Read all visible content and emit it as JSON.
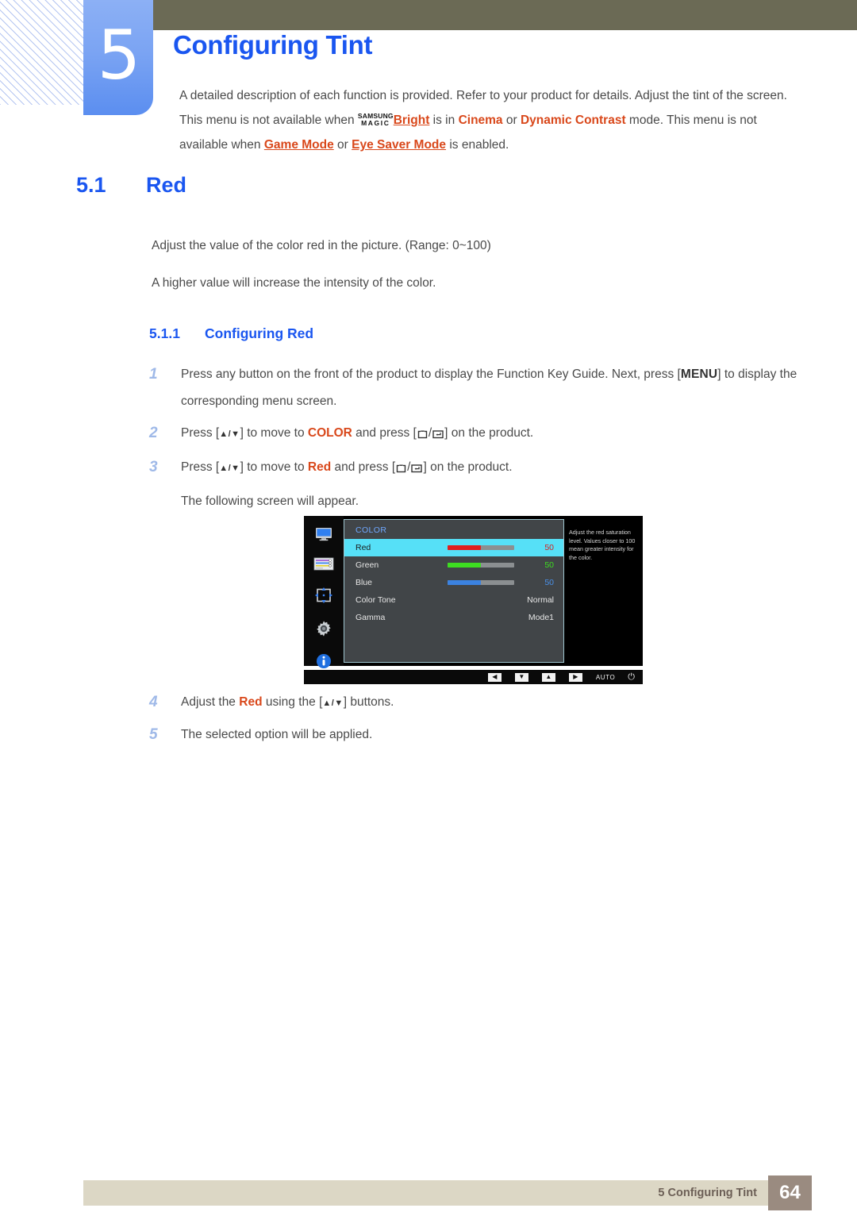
{
  "chapter": {
    "number": "5",
    "title": "Configuring Tint",
    "intro_parts": {
      "p1": "A detailed description of each function is provided. Refer to your product for details. Adjust the tint of the screen. This menu is not available when ",
      "magic_line1": "SAMSUNG",
      "magic_line2": "MAGIC",
      "bright": "Bright",
      "p2": " is in ",
      "cinema": "Cinema",
      "p3": " or ",
      "dynamic_contrast": "Dynamic Contrast",
      "p4": " mode. This menu is not available when ",
      "game_mode": "Game Mode",
      "p5": " or ",
      "eye_saver_mode": "Eye Saver Mode",
      "p6": " is enabled."
    }
  },
  "section": {
    "number": "5.1",
    "title": "Red",
    "para1": "Adjust the value of the color red in the picture. (Range: 0~100)",
    "para2": "A higher value will increase the intensity of the color."
  },
  "subsection": {
    "number": "5.1.1",
    "title": "Configuring Red"
  },
  "steps": [
    {
      "index": "1",
      "t1": "Press any button on the front of the product to display the Function Key Guide. Next, press [",
      "kbd": "MENU",
      "t2": "] to display the corresponding menu screen."
    },
    {
      "index": "2",
      "t1": "Press [",
      "arrows": "▲/▼",
      "t2": "] to move to ",
      "hl": "COLOR",
      "t3": " and press [",
      "t4": "] on the product."
    },
    {
      "index": "3",
      "t1": "Press [",
      "arrows": "▲/▼",
      "t2": "] to move to ",
      "hl": "Red",
      "t3": " and press [",
      "t4": "] on the product."
    },
    {
      "index": "4",
      "t1": "Adjust the ",
      "hl": "Red",
      "t2": " using the [",
      "arrows": "▲/▼",
      "t3": "] buttons."
    },
    {
      "index": "5",
      "t1": "The selected option will be applied."
    }
  ],
  "substep_note": "The following screen will appear.",
  "osd": {
    "menu_title": "COLOR",
    "rows": [
      {
        "label": "Red",
        "value": "50",
        "type": "slider",
        "fill": "50%",
        "color": "#e01f1f",
        "value_color": "#d32020",
        "selected": true
      },
      {
        "label": "Green",
        "value": "50",
        "type": "slider",
        "fill": "50%",
        "color": "#3ddd21",
        "value_color": "#3ddd21",
        "selected": false
      },
      {
        "label": "Blue",
        "value": "50",
        "type": "slider",
        "fill": "50%",
        "color": "#3b82e0",
        "value_color": "#4a90e8",
        "selected": false
      },
      {
        "label": "Color Tone",
        "value": "Normal",
        "type": "text",
        "selected": false
      },
      {
        "label": "Gamma",
        "value": "Mode1",
        "type": "text",
        "selected": false
      }
    ],
    "help_text": "Adjust the red saturation level. Values closer to 100 mean greater intensity for the color.",
    "sidebar_icons": [
      "monitor-icon",
      "picture-sliders-icon",
      "screen-adjust-icon",
      "gear-icon",
      "info-icon"
    ],
    "bottom_buttons": [
      "◀",
      "▼",
      "▲",
      "▶"
    ],
    "auto_label": "AUTO",
    "power_icon": "⏻"
  },
  "footer": {
    "text": "5 Configuring Tint",
    "page": "64"
  },
  "colors": {
    "heading_blue": "#1a56f0",
    "accent_orange": "#d9481b",
    "olive": "#6b6a55",
    "tab_blue": "#5b8ef0",
    "footer_bg": "#dcd7c5",
    "page_box": "#9a8b80"
  }
}
